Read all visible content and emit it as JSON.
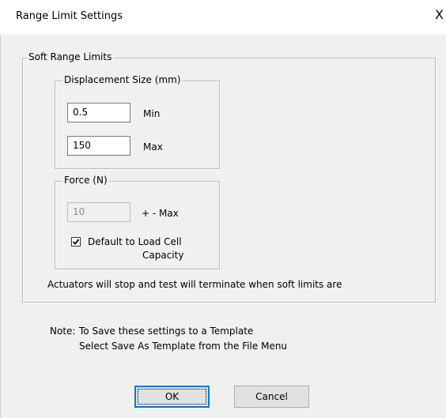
{
  "window": {
    "title": "Range Limit Settings",
    "close_glyph": "X"
  },
  "soft_limits": {
    "legend": "Soft Range Limits",
    "displacement": {
      "legend": "Displacement Size (mm)",
      "min_value": "0.5",
      "min_label": "Min",
      "max_value": "150",
      "max_label": "Max"
    },
    "force": {
      "legend": "Force (N)",
      "max_value": "10",
      "max_label": "+ - Max",
      "default_checkbox": {
        "checked": true,
        "label_line1": "Default to Load Cell",
        "label_line2": "Capacity"
      }
    },
    "info_text": "Actuators will stop and test will terminate when soft limits are"
  },
  "note": {
    "prefix": "Note:",
    "line1": "To Save these settings to a Template",
    "line2": "Select Save As Template from the File Menu"
  },
  "buttons": {
    "ok_label": "OK",
    "cancel_label": "Cancel"
  }
}
